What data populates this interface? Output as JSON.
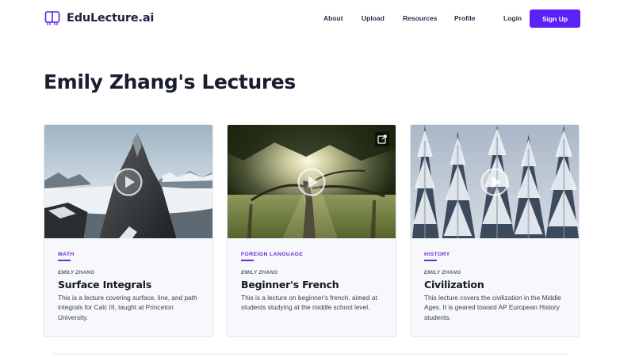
{
  "header": {
    "brand": "EduLecture.ai",
    "nav": [
      "About",
      "Upload",
      "Resources",
      "Profile"
    ],
    "login_label": "Login",
    "signup_label": "Sign Up"
  },
  "page_title": "Emily Zhang's Lectures",
  "cards": [
    {
      "category": "MATH",
      "author": "EMILY ZHANG",
      "title": "Surface Integrals",
      "description": "This is a lecture covering surface, line, and path integrals for Calc III, taught at Princeton University."
    },
    {
      "category": "FOREIGN LANGUAGE",
      "author": "EMILY ZHANG",
      "title": "Beginner's French",
      "description": "This is a lecture on beginner's french, aimed at students studying at the middle school level."
    },
    {
      "category": "HISTORY",
      "author": "EMILY ZHANG",
      "title": "Civilization",
      "description": "This lecture covers the civilization in the Middle Ages. It is geared toward AP European History students."
    }
  ],
  "colors": {
    "accent": "#5b21f5",
    "category": "#6d28d9"
  }
}
